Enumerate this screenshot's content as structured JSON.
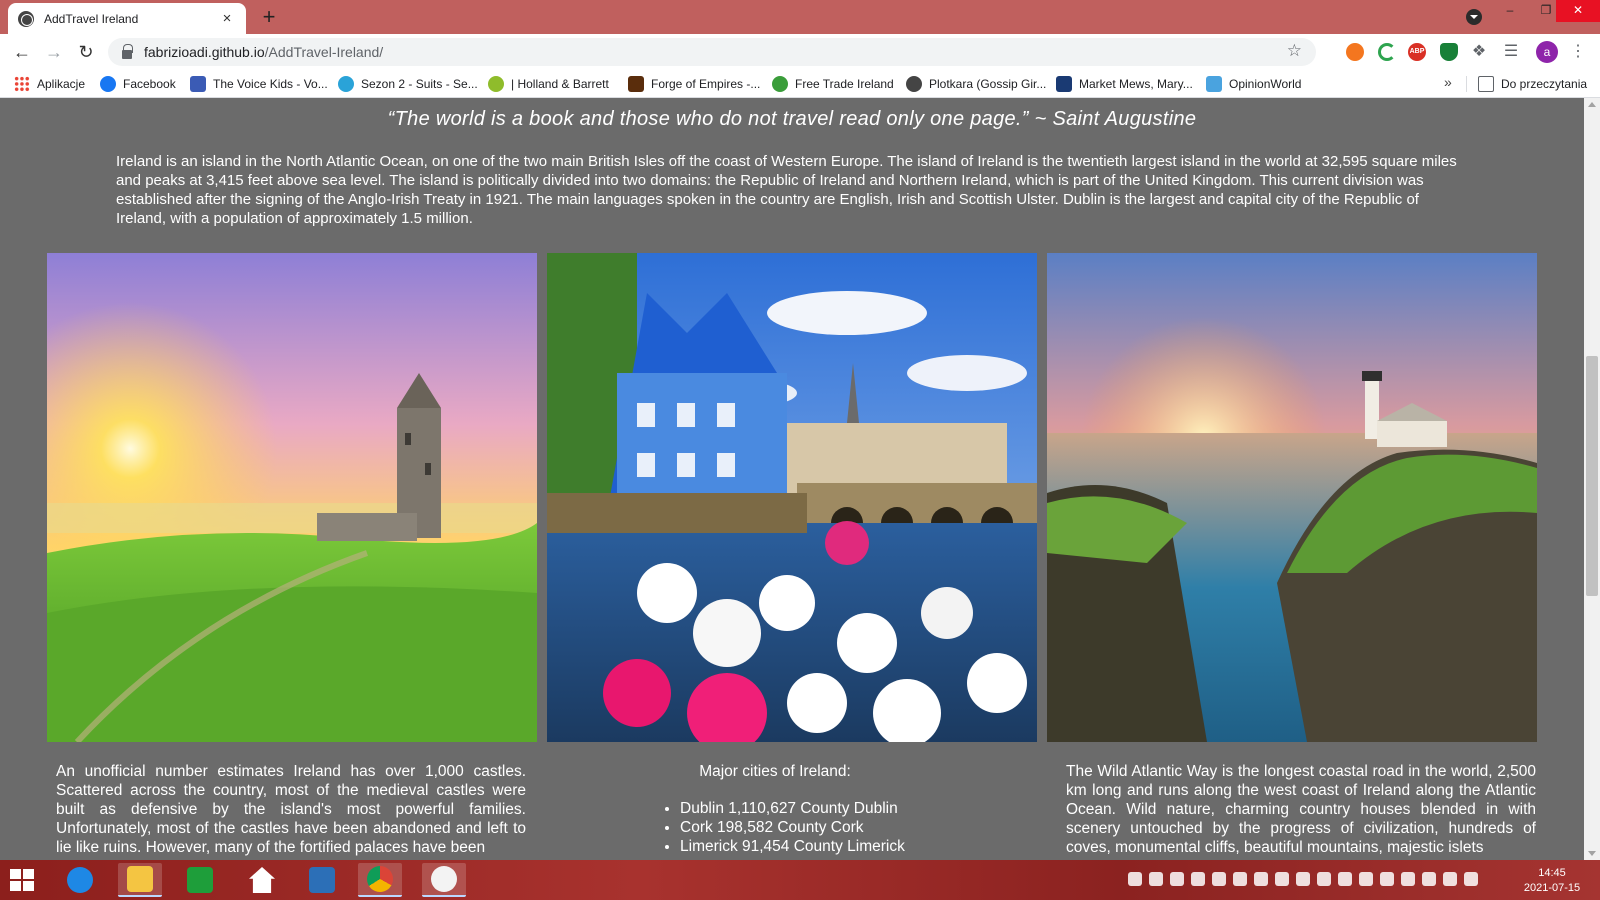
{
  "browser": {
    "tab_title": "AddTravel Ireland",
    "tab_close_icon": "×",
    "new_tab_icon": "+",
    "url_host": "fabrizioadi.github.io",
    "url_path": "/AddTravel-Ireland/",
    "avatar_letter": "a",
    "window_controls": {
      "minimize": "–",
      "maximize": "❐",
      "close": "✕"
    }
  },
  "bookmarks": [
    {
      "label": "Aplikacje",
      "icon": "apps-grid-icon",
      "color": "#ea4335"
    },
    {
      "label": "Facebook",
      "icon": "facebook-icon",
      "color": "#1877f2"
    },
    {
      "label": "The Voice Kids - Vo...",
      "icon": "voice-kids-icon",
      "color": "#3b5bb5"
    },
    {
      "label": "Sezon 2 - Suits - Se...",
      "icon": "cloud-icon",
      "color": "#2aa3d8"
    },
    {
      "label": "| Holland & Barrett",
      "icon": "leaf-icon",
      "color": "#8fbc2b"
    },
    {
      "label": "Forge of Empires -...",
      "icon": "forge-icon",
      "color": "#5a2d0c"
    },
    {
      "label": "Free Trade Ireland",
      "icon": "ft-icon",
      "color": "#3a9d3a"
    },
    {
      "label": "Plotkara (Gossip Gir...",
      "icon": "globe-icon",
      "color": "#444444"
    },
    {
      "label": "Market Mews, Mary...",
      "icon": "market-icon",
      "color": "#1a3a73"
    },
    {
      "label": "OpinionWorld",
      "icon": "opinion-icon",
      "color": "#4aa3df"
    }
  ],
  "bookmarks_more": "»",
  "reading_list": "Do przeczytania",
  "page": {
    "quote": "“The world is a book and those who do not travel read only one page.” ~ Saint Augustine",
    "intro": "Ireland is an island in the North Atlantic Ocean, on one of the two main British Isles off the coast of Western Europe. The island of Ireland is the twentieth largest island in the world at 32,595 square miles and peaks at 3,415 feet above sea level. The island is politically divided into two domains: the Republic of Ireland and Northern Ireland, which is part of the United Kingdom. This current division was established after the signing of the Anglo-Irish Treaty in 1921. The main languages spoken in the country are English, Irish and Scottish Ulster. Dublin is the largest and capital city of the Republic of Ireland, with a population of approximately 1.5 million.",
    "castles_text": "An unofficial number estimates Ireland has over 1,000 castles. Scattered across the country, most of the medieval castles were built as defensive by the island's most powerful families. Unfortunately, most of the castles have been abandoned and left to lie like ruins. However, many of the fortified palaces have been",
    "cities_title": "Major cities of Ireland:",
    "cities": [
      "Dublin 1,110,627 County Dublin",
      "Cork 198,582 County Cork",
      "Limerick 91,454 County Limerick"
    ],
    "coast_text": "The Wild Atlantic Way is the longest coastal road in the world, 2,500 km long and runs along the west coast of Ireland along the Atlantic Ocean. Wild nature, charming country houses blended in with scenery untouched by the progress of civilization, hundreds of coves, monumental cliffs, beautiful mountains, majestic islets"
  },
  "taskbar": {
    "time": "14:45",
    "date": "2021-07-15",
    "apps": [
      "internet-explorer-icon",
      "file-explorer-icon",
      "store-icon",
      "home-icon",
      "computer-icon",
      "chrome-icon",
      "slack-icon"
    ]
  }
}
